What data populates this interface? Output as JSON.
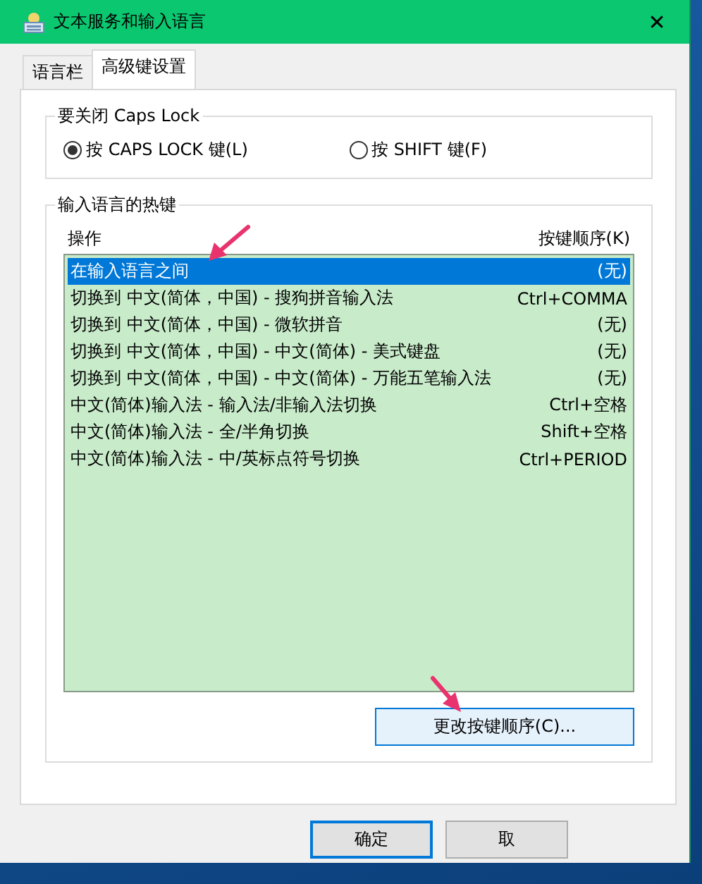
{
  "window": {
    "title": "文本服务和输入语言",
    "close": "✕"
  },
  "tabs": [
    {
      "label": "语言栏",
      "selected": false
    },
    {
      "label": "高级键设置",
      "selected": true
    }
  ],
  "caps_lock_group": {
    "title": "要关闭 Caps Lock",
    "options": [
      {
        "label": "按 CAPS LOCK 键(L)",
        "selected": true
      },
      {
        "label": "按 SHIFT 键(F)",
        "selected": false
      }
    ]
  },
  "hotkeys_group": {
    "title": "输入语言的热键",
    "columns": [
      "操作",
      "按键顺序(K)"
    ],
    "rows": [
      {
        "action": "在输入语言之间",
        "keys": "(无)",
        "selected": true
      },
      {
        "action": "切换到 中文(简体，中国) - 搜狗拼音输入法",
        "keys": "Ctrl+COMMA",
        "selected": false
      },
      {
        "action": "切换到 中文(简体，中国) - 微软拼音",
        "keys": "(无)",
        "selected": false
      },
      {
        "action": "切换到 中文(简体，中国) - 中文(简体) - 美式键盘",
        "keys": "(无)",
        "selected": false
      },
      {
        "action": "切换到 中文(简体，中国) - 中文(简体) - 万能五笔输入法",
        "keys": "(无)",
        "selected": false
      },
      {
        "action": "中文(简体)输入法 - 输入法/非输入法切换",
        "keys": "Ctrl+空格",
        "selected": false
      },
      {
        "action": "中文(简体)输入法 - 全/半角切换",
        "keys": "Shift+空格",
        "selected": false
      },
      {
        "action": "中文(简体)输入法 - 中/英标点符号切换",
        "keys": "Ctrl+PERIOD",
        "selected": false
      }
    ],
    "change_button": "更改按键顺序(C)..."
  },
  "buttons": [
    {
      "label": "确定",
      "default": true
    },
    {
      "label": "取",
      "default": false
    }
  ]
}
